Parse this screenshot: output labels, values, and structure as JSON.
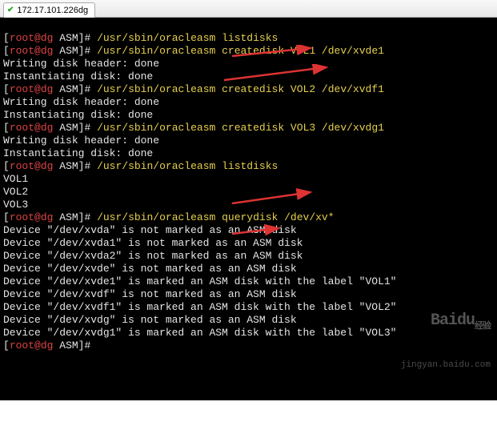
{
  "tab": {
    "ip": "172.17.101.226dg"
  },
  "prompt": {
    "user": "root",
    "host": "dg",
    "dir": "ASM"
  },
  "cmd": {
    "listdisks": "/usr/sbin/oracleasm listdisks",
    "create_vol1": "/usr/sbin/oracleasm createdisk VOL1 /dev/xvde1",
    "create_vol2": "/usr/sbin/oracleasm createdisk VOL2 /dev/xvdf1",
    "create_vol3": "/usr/sbin/oracleasm createdisk VOL3 /dev/xvdg1",
    "querydisk": "/usr/sbin/oracleasm querydisk /dev/xv*"
  },
  "out": {
    "writing": "Writing disk header: done",
    "instantiate": "Instantiating disk: done",
    "vols": [
      "VOL1",
      "VOL2",
      "VOL3"
    ],
    "query": [
      "Device \"/dev/xvda\" is not marked as an ASM disk",
      "Device \"/dev/xvda1\" is not marked as an ASM disk",
      "Device \"/dev/xvda2\" is not marked as an ASM disk",
      "Device \"/dev/xvde\" is not marked as an ASM disk",
      "Device \"/dev/xvde1\" is marked an ASM disk with the label \"VOL1\"",
      "Device \"/dev/xvdf\" is not marked as an ASM disk",
      "Device \"/dev/xvdf1\" is marked an ASM disk with the label \"VOL2\"",
      "Device \"/dev/xvdg\" is not marked as an ASM disk",
      "Device \"/dev/xvdg1\" is marked an ASM disk with the label \"VOL3\""
    ]
  },
  "wm": {
    "brand": "Bai",
    "brand2": "du",
    "suffix": "经验",
    "url": "jingyan.baidu.com"
  }
}
